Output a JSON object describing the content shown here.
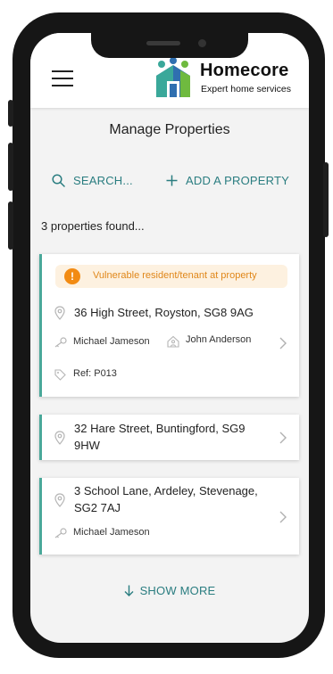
{
  "brand": {
    "name": "Homecore",
    "tagline": "Expert home services",
    "colors": {
      "blue": "#2f6fb0",
      "teal": "#3aa89a",
      "green": "#6fba3f"
    }
  },
  "header": {
    "menu_icon": "hamburger-menu-icon"
  },
  "page": {
    "title": "Manage Properties"
  },
  "actions": {
    "search_label": "SEARCH...",
    "add_label": "ADD A PROPERTY"
  },
  "results": {
    "count_text": "3 properties found..."
  },
  "properties": [
    {
      "alert": "Vulnerable resident/tenant at property",
      "address_lines": [
        "36 High Street, Royston, SG8 9AG"
      ],
      "owner": "Michael Jameson",
      "tenant": "John Anderson",
      "ref": "Ref: P013"
    },
    {
      "address_lines": [
        "32 Hare Street, Buntingford, SG9",
        "9HW"
      ]
    },
    {
      "address_lines": [
        "3 School Lane, Ardeley, Stevenage,",
        "SG2 7AJ"
      ],
      "owner": "Michael Jameson"
    }
  ],
  "footer": {
    "show_more_label": "SHOW MORE"
  },
  "colors": {
    "accent": "#2a7d80",
    "card_border": "#4aa89a",
    "alert_bg": "#fdf1e0",
    "alert_icon": "#f28b13"
  }
}
